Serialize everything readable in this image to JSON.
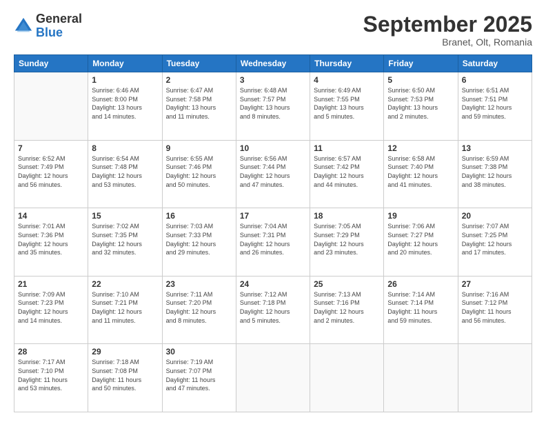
{
  "logo": {
    "general": "General",
    "blue": "Blue"
  },
  "header": {
    "month": "September 2025",
    "location": "Branet, Olt, Romania"
  },
  "days_of_week": [
    "Sunday",
    "Monday",
    "Tuesday",
    "Wednesday",
    "Thursday",
    "Friday",
    "Saturday"
  ],
  "weeks": [
    [
      {
        "day": "",
        "info": ""
      },
      {
        "day": "1",
        "info": "Sunrise: 6:46 AM\nSunset: 8:00 PM\nDaylight: 13 hours\nand 14 minutes."
      },
      {
        "day": "2",
        "info": "Sunrise: 6:47 AM\nSunset: 7:58 PM\nDaylight: 13 hours\nand 11 minutes."
      },
      {
        "day": "3",
        "info": "Sunrise: 6:48 AM\nSunset: 7:57 PM\nDaylight: 13 hours\nand 8 minutes."
      },
      {
        "day": "4",
        "info": "Sunrise: 6:49 AM\nSunset: 7:55 PM\nDaylight: 13 hours\nand 5 minutes."
      },
      {
        "day": "5",
        "info": "Sunrise: 6:50 AM\nSunset: 7:53 PM\nDaylight: 13 hours\nand 2 minutes."
      },
      {
        "day": "6",
        "info": "Sunrise: 6:51 AM\nSunset: 7:51 PM\nDaylight: 12 hours\nand 59 minutes."
      }
    ],
    [
      {
        "day": "7",
        "info": "Sunrise: 6:52 AM\nSunset: 7:49 PM\nDaylight: 12 hours\nand 56 minutes."
      },
      {
        "day": "8",
        "info": "Sunrise: 6:54 AM\nSunset: 7:48 PM\nDaylight: 12 hours\nand 53 minutes."
      },
      {
        "day": "9",
        "info": "Sunrise: 6:55 AM\nSunset: 7:46 PM\nDaylight: 12 hours\nand 50 minutes."
      },
      {
        "day": "10",
        "info": "Sunrise: 6:56 AM\nSunset: 7:44 PM\nDaylight: 12 hours\nand 47 minutes."
      },
      {
        "day": "11",
        "info": "Sunrise: 6:57 AM\nSunset: 7:42 PM\nDaylight: 12 hours\nand 44 minutes."
      },
      {
        "day": "12",
        "info": "Sunrise: 6:58 AM\nSunset: 7:40 PM\nDaylight: 12 hours\nand 41 minutes."
      },
      {
        "day": "13",
        "info": "Sunrise: 6:59 AM\nSunset: 7:38 PM\nDaylight: 12 hours\nand 38 minutes."
      }
    ],
    [
      {
        "day": "14",
        "info": "Sunrise: 7:01 AM\nSunset: 7:36 PM\nDaylight: 12 hours\nand 35 minutes."
      },
      {
        "day": "15",
        "info": "Sunrise: 7:02 AM\nSunset: 7:35 PM\nDaylight: 12 hours\nand 32 minutes."
      },
      {
        "day": "16",
        "info": "Sunrise: 7:03 AM\nSunset: 7:33 PM\nDaylight: 12 hours\nand 29 minutes."
      },
      {
        "day": "17",
        "info": "Sunrise: 7:04 AM\nSunset: 7:31 PM\nDaylight: 12 hours\nand 26 minutes."
      },
      {
        "day": "18",
        "info": "Sunrise: 7:05 AM\nSunset: 7:29 PM\nDaylight: 12 hours\nand 23 minutes."
      },
      {
        "day": "19",
        "info": "Sunrise: 7:06 AM\nSunset: 7:27 PM\nDaylight: 12 hours\nand 20 minutes."
      },
      {
        "day": "20",
        "info": "Sunrise: 7:07 AM\nSunset: 7:25 PM\nDaylight: 12 hours\nand 17 minutes."
      }
    ],
    [
      {
        "day": "21",
        "info": "Sunrise: 7:09 AM\nSunset: 7:23 PM\nDaylight: 12 hours\nand 14 minutes."
      },
      {
        "day": "22",
        "info": "Sunrise: 7:10 AM\nSunset: 7:21 PM\nDaylight: 12 hours\nand 11 minutes."
      },
      {
        "day": "23",
        "info": "Sunrise: 7:11 AM\nSunset: 7:20 PM\nDaylight: 12 hours\nand 8 minutes."
      },
      {
        "day": "24",
        "info": "Sunrise: 7:12 AM\nSunset: 7:18 PM\nDaylight: 12 hours\nand 5 minutes."
      },
      {
        "day": "25",
        "info": "Sunrise: 7:13 AM\nSunset: 7:16 PM\nDaylight: 12 hours\nand 2 minutes."
      },
      {
        "day": "26",
        "info": "Sunrise: 7:14 AM\nSunset: 7:14 PM\nDaylight: 11 hours\nand 59 minutes."
      },
      {
        "day": "27",
        "info": "Sunrise: 7:16 AM\nSunset: 7:12 PM\nDaylight: 11 hours\nand 56 minutes."
      }
    ],
    [
      {
        "day": "28",
        "info": "Sunrise: 7:17 AM\nSunset: 7:10 PM\nDaylight: 11 hours\nand 53 minutes."
      },
      {
        "day": "29",
        "info": "Sunrise: 7:18 AM\nSunset: 7:08 PM\nDaylight: 11 hours\nand 50 minutes."
      },
      {
        "day": "30",
        "info": "Sunrise: 7:19 AM\nSunset: 7:07 PM\nDaylight: 11 hours\nand 47 minutes."
      },
      {
        "day": "",
        "info": ""
      },
      {
        "day": "",
        "info": ""
      },
      {
        "day": "",
        "info": ""
      },
      {
        "day": "",
        "info": ""
      }
    ]
  ]
}
